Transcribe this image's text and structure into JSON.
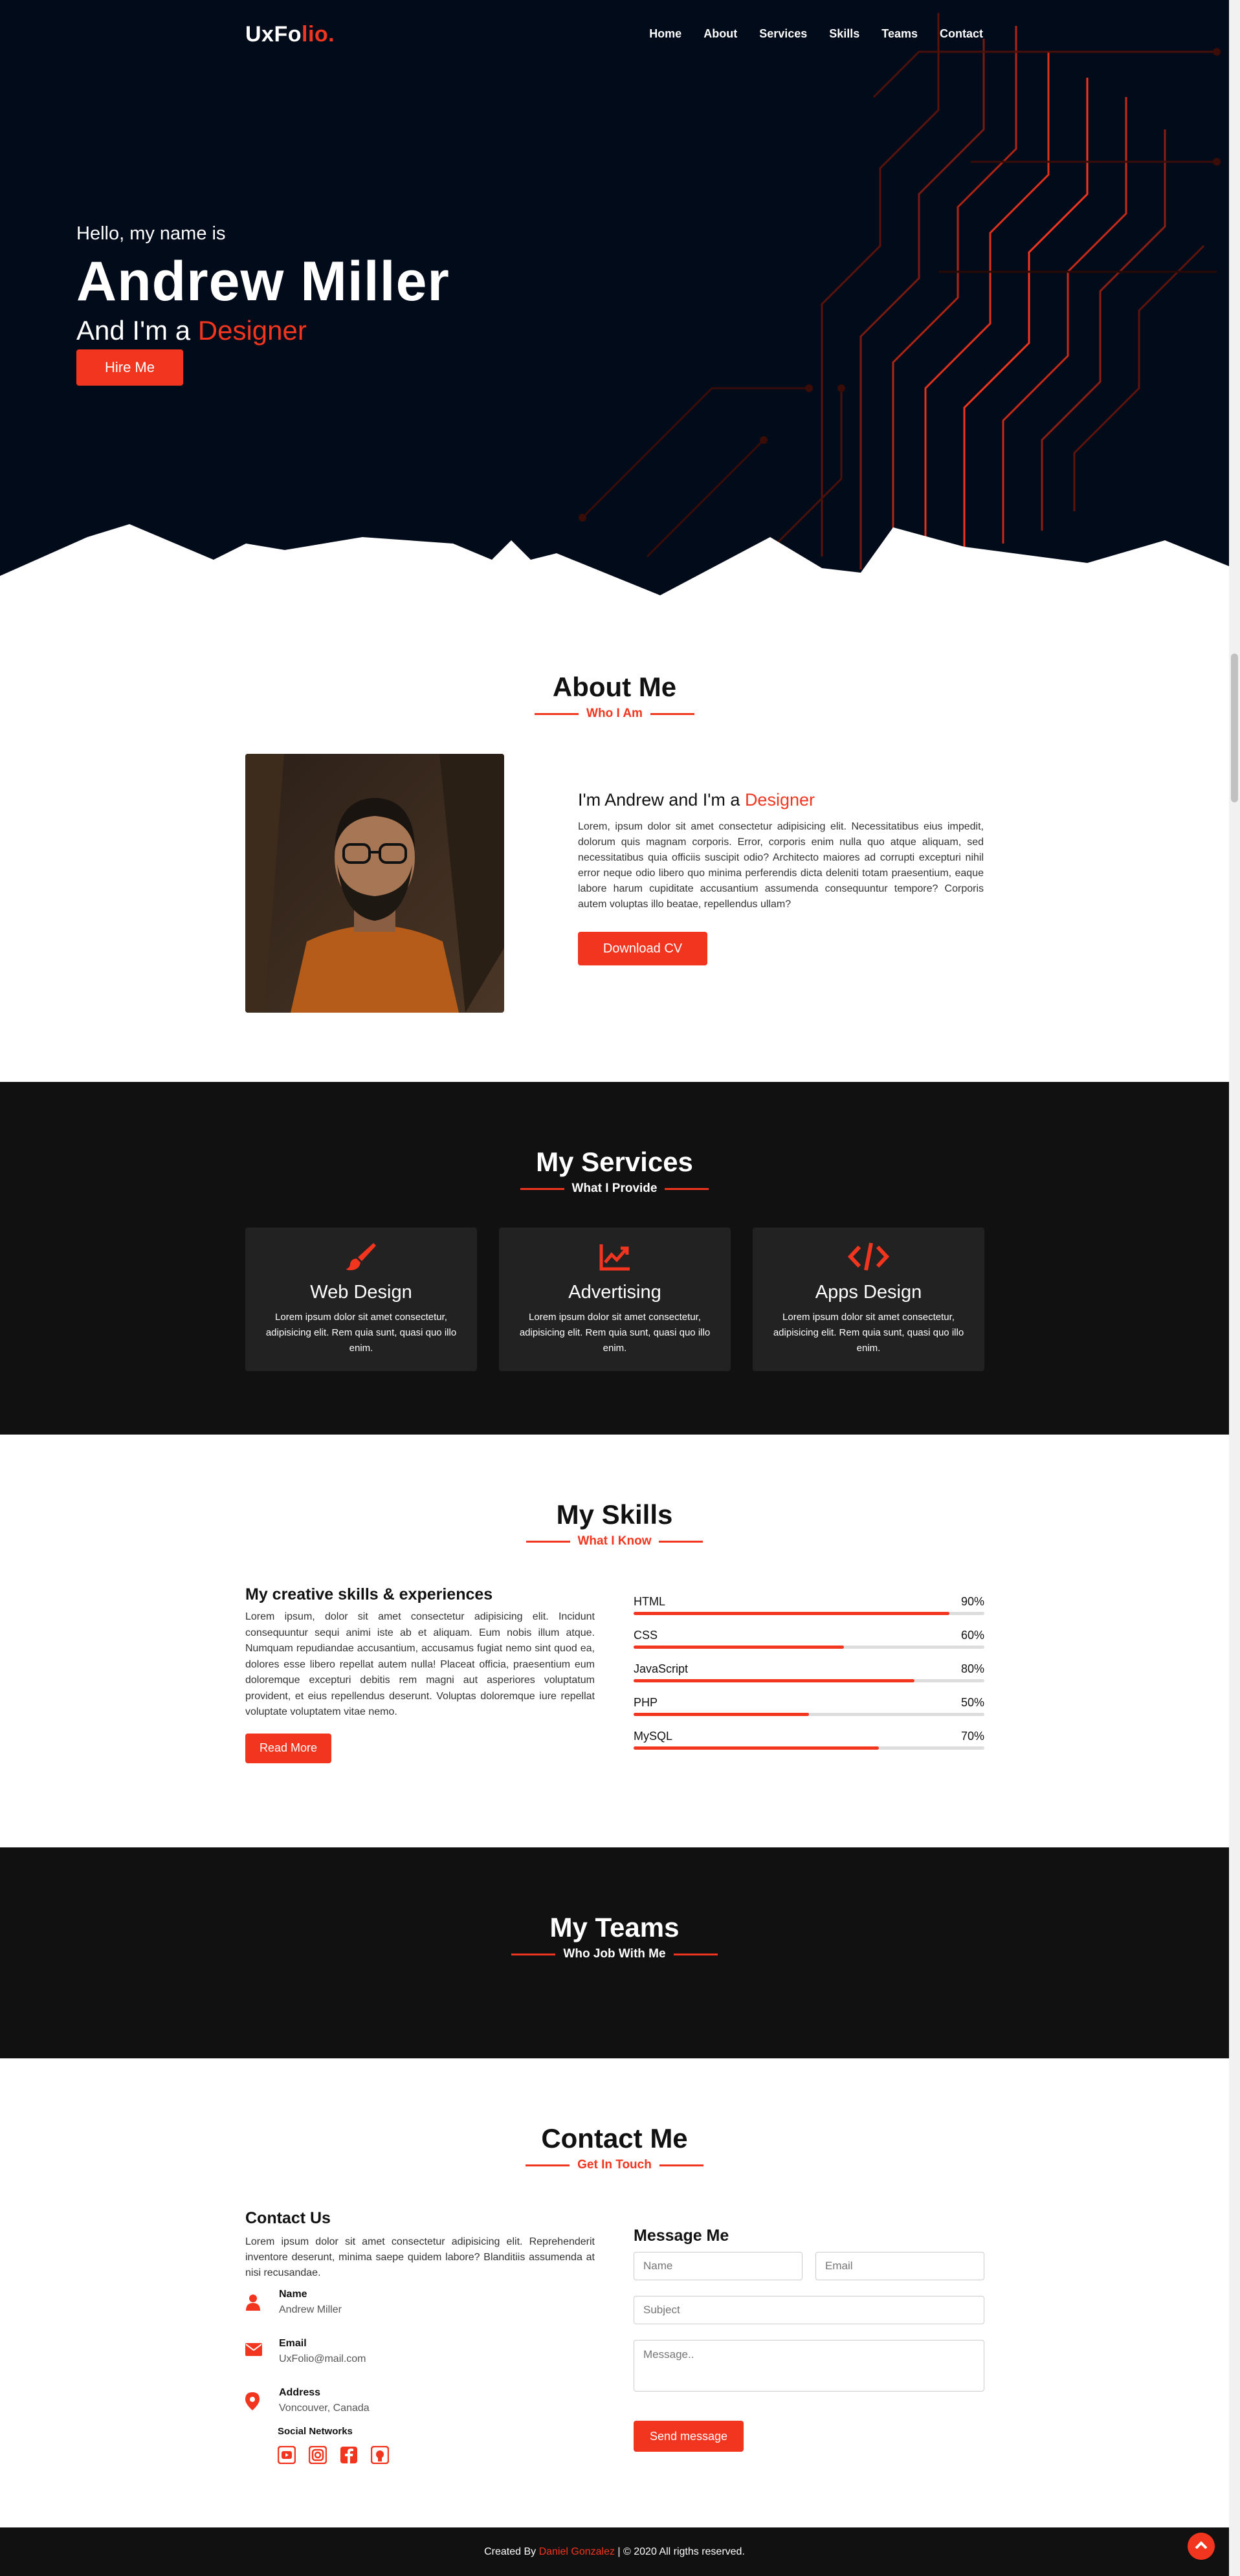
{
  "brand": {
    "name": "UxFo",
    "name_accent": "lio."
  },
  "nav": {
    "items": [
      "Home",
      "About",
      "Services",
      "Skills",
      "Teams",
      "Contact"
    ]
  },
  "hero": {
    "greeting": "Hello, my name is",
    "name": "Andrew Miller",
    "role_prefix": "And I'm a ",
    "role": "Designer",
    "hire_button": "Hire Me"
  },
  "about": {
    "title": "About Me",
    "subtitle": "Who I Am",
    "heading_prefix": "I'm Andrew and I'm a ",
    "heading_accent": "Designer",
    "text": "Lorem, ipsum dolor sit amet consectetur adipisicing elit. Necessitatibus eius impedit, dolorum quis magnam corporis. Error, corporis enim nulla quo atque aliquam, sed necessitatibus quia officiis suscipit odio? Architecto maiores ad corrupti excepturi nihil error neque odio libero quo minima perferendis dicta deleniti totam praesentium, eaque labore harum cupiditate accusantium assumenda consequuntur tempore? Corporis autem voluptas illo beatae, repellendus ullam?",
    "download_button": "Download CV"
  },
  "services": {
    "title": "My Services",
    "subtitle": "What I Provide",
    "items": [
      {
        "title": "Web Design",
        "icon": "brush-icon",
        "text": "Lorem ipsum dolor sit amet consectetur, adipisicing elit. Rem quia sunt, quasi quo illo enim."
      },
      {
        "title": "Advertising",
        "icon": "chart-line-icon",
        "text": "Lorem ipsum dolor sit amet consectetur, adipisicing elit. Rem quia sunt, quasi quo illo enim."
      },
      {
        "title": "Apps Design",
        "icon": "code-icon",
        "text": "Lorem ipsum dolor sit amet consectetur, adipisicing elit. Rem quia sunt, quasi quo illo enim."
      }
    ]
  },
  "skills": {
    "title": "My Skills",
    "subtitle": "What I Know",
    "heading": "My creative skills & experiences",
    "text": "Lorem ipsum, dolor sit amet consectetur adipisicing elit. Incidunt consequuntur sequi animi iste ab et aliquam. Eum nobis illum atque. Numquam repudiandae accusantium, accusamus fugiat nemo sint quod ea, dolores esse libero repellat autem nulla! Placeat officia, praesentium eum doloremque excepturi debitis rem magni aut asperiores voluptatum provident, et eius repellendus deserunt. Voluptas doloremque iure repellat voluptate voluptatem vitae nemo.",
    "read_more": "Read More",
    "list": [
      {
        "name": "HTML",
        "percent_label": "90%",
        "value": 0.9
      },
      {
        "name": "CSS",
        "percent_label": "60%",
        "value": 0.6
      },
      {
        "name": "JavaScript",
        "percent_label": "80%",
        "value": 0.8
      },
      {
        "name": "PHP",
        "percent_label": "50%",
        "value": 0.5
      },
      {
        "name": "MySQL",
        "percent_label": "70%",
        "value": 0.7
      }
    ]
  },
  "teams": {
    "title": "My Teams",
    "subtitle": "Who Job With Me"
  },
  "contact": {
    "title": "Contact Me",
    "subtitle": "Get In Touch",
    "us_heading": "Contact Us",
    "us_text": "Lorem ipsum dolor sit amet consectetur adipisicing elit. Reprehenderit inventore deserunt, minima saepe quidem labore? Blanditiis assumenda at nisi recusandae.",
    "info": [
      {
        "label": "Name",
        "value": "Andrew Miller",
        "icon": "user-icon"
      },
      {
        "label": "Email",
        "value": "UxFolio@mail.com",
        "icon": "envelope-icon"
      },
      {
        "label": "Address",
        "value": "Voncouver, Canada",
        "icon": "map-pin-icon"
      }
    ],
    "social_title": "Social Networks",
    "socials": [
      "youtube-icon",
      "instagram-icon",
      "facebook-icon",
      "github-icon"
    ],
    "form_heading": "Message Me",
    "placeholders": {
      "name": "Name",
      "email": "Email",
      "subject": "Subject",
      "message": "Message.."
    },
    "send_button": "Send message"
  },
  "footer": {
    "prefix": "Created By ",
    "author": "Daniel Gonzalez",
    "suffix": " | © 2020 All rigths reserved."
  },
  "colors": {
    "accent": "#f2351f",
    "hero_bg": "#020b1a",
    "dark_bg": "#111111",
    "card_bg": "#222222"
  }
}
